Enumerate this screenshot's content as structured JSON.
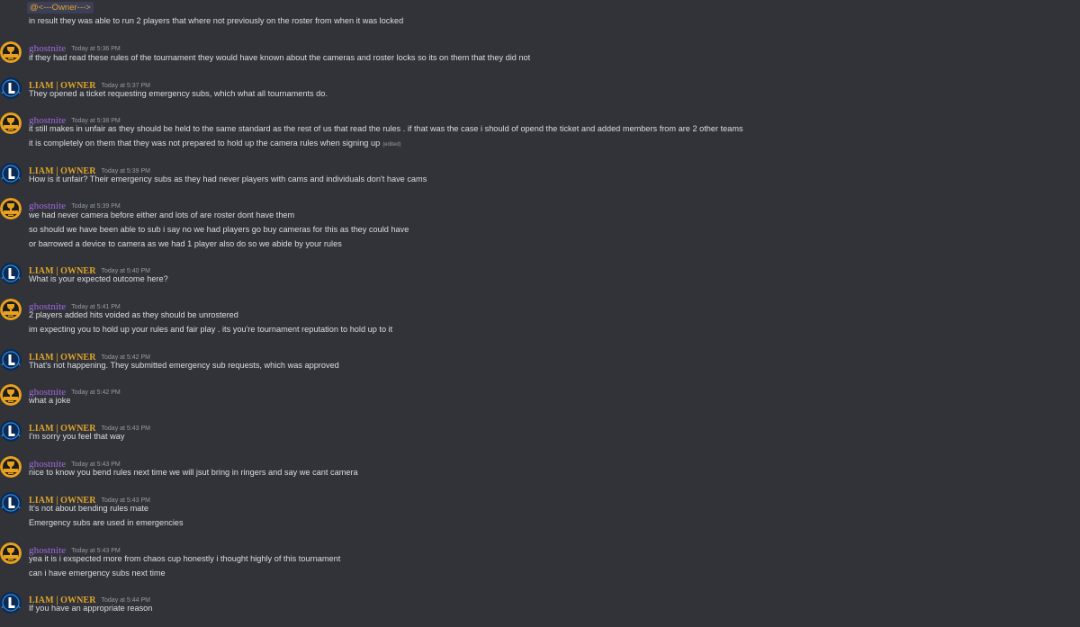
{
  "owner_mention": "@<---Owner--->",
  "intro_line": "in result they was able to run 2 players that where not previously on the roster  from when it was locked",
  "messages": [
    {
      "author": "ghostnite",
      "time": "Today at 5:36 PM",
      "lines": [
        "if they had read these rules of the tournament they would have known about the cameras and roster locks   so its on them that they did not"
      ]
    },
    {
      "author": "LIAM | OWNER",
      "time": "Today at 5:37 PM",
      "lines": [
        "They opened a ticket requesting emergency subs, which what all tournaments do."
      ]
    },
    {
      "author": "ghostnite",
      "time": "Today at 5:38 PM",
      "lines": [
        "it still makes in unfair as they should be held to the same standard as the rest of us that read the rules . if that was the case i should of opend the ticket and added  members from are 2 other teams",
        "it is completely on them that they was not prepared to hold up the camera rules  when signing up"
      ],
      "edited": "(edited)"
    },
    {
      "author": "LIAM | OWNER",
      "time": "Today at 5:39 PM",
      "lines": [
        "How is it unfair? Their emergency subs as they had never players with cams and individuals don't have cams"
      ]
    },
    {
      "author": "ghostnite",
      "time": "Today at 5:39 PM",
      "lines": [
        "we had never camera before either and lots of are roster dont have them",
        "so should we have been able to sub   i say no we had players go buy cameras for this as they could have",
        "or barrowed a device  to camera as we had 1 player also do so we abide by your rules"
      ]
    },
    {
      "author": "LIAM | OWNER",
      "time": "Today at 5:40 PM",
      "lines": [
        "What is your expected outcome here?"
      ]
    },
    {
      "author": "ghostnite",
      "time": "Today at 5:41 PM",
      "lines": [
        "2 players added  hits voided as they should be unrostered",
        "im expecting you to hold up your  rules  and fair play . its you're tournament reputation to hold up to it"
      ]
    },
    {
      "author": "LIAM | OWNER",
      "time": "Today at 5:42 PM",
      "lines": [
        "That's not happening. They submitted emergency sub requests, which was approved"
      ]
    },
    {
      "author": "ghostnite",
      "time": "Today at 5:42 PM",
      "lines": [
        "what a joke"
      ]
    },
    {
      "author": "LIAM | OWNER",
      "time": "Today at 5:43 PM",
      "lines": [
        "I'm sorry you feel that way"
      ]
    },
    {
      "author": "ghostnite",
      "time": "Today at 5:43 PM",
      "lines": [
        "nice to know you bend rules    next time we will jsut bring in ringers and say we cant camera"
      ]
    },
    {
      "author": "LIAM | OWNER",
      "time": "Today at 5:43 PM",
      "lines": [
        "It's not about bending rules mate",
        "Emergency subs are used in emergencies"
      ]
    },
    {
      "author": "ghostnite",
      "time": "Today at 5:43 PM",
      "lines": [
        "yea it is  i exspected more from chaos cup honestly i thought highly of this tournament",
        "can i have emergency subs next time"
      ]
    },
    {
      "author": "LIAM | OWNER",
      "time": "Today at 5:44 PM",
      "lines": [
        "If you have an appropriate reason"
      ]
    }
  ],
  "colors": {
    "background": "#313338",
    "ghostnite_name": "#a06be0",
    "liam_name": "#e0a52a",
    "text": "#dbdee1",
    "timestamp": "#949ba4"
  },
  "icons": {
    "ghostnite_avatar": "trophy-badge-avatar-icon",
    "liam_avatar": "letter-l-logo-avatar-icon"
  }
}
